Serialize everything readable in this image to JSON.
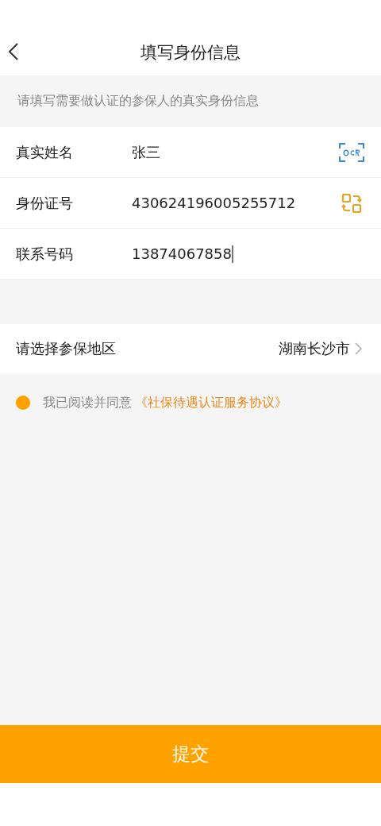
{
  "header": {
    "title": "填写身份信息"
  },
  "hint": "请填写需要做认证的参保人的真实身份信息",
  "fields": [
    {
      "label": "真实姓名",
      "value": "张三",
      "kind": "ocr",
      "focused": false
    },
    {
      "label": "身份证号",
      "value": "430624196005255712",
      "kind": "scan",
      "focused": false
    },
    {
      "label": "联系号码",
      "value": "13874067858",
      "kind": "plain",
      "focused": true
    }
  ],
  "region": {
    "label": "请选择参保地区",
    "value": "湖南长沙市"
  },
  "agreement": {
    "agreed": true,
    "text": "我已阅读并同意",
    "link": "《社保待遇认证服务协议》"
  },
  "submit": "提交"
}
